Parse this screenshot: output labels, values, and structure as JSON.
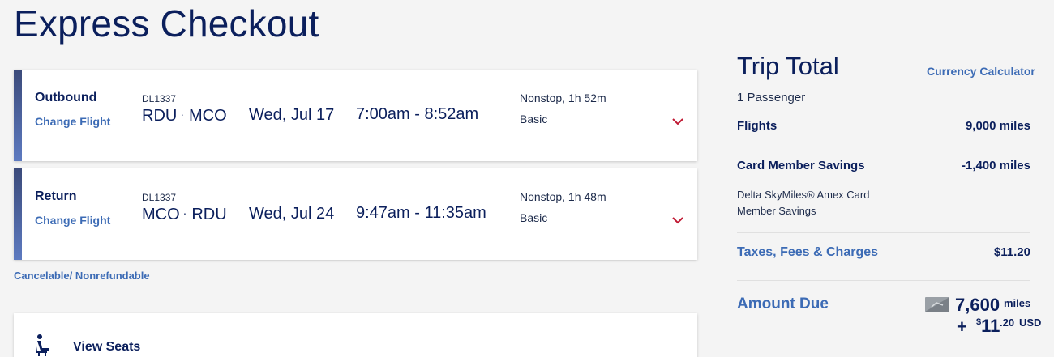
{
  "page": {
    "title": "Express Checkout"
  },
  "flights": [
    {
      "leg": "Outbound",
      "change_label": "Change Flight",
      "flight_number": "DL1337",
      "origin": "RDU",
      "destination": "MCO",
      "date": "Wed, Jul 17",
      "times": "7:00am - 8:52am",
      "duration": "Nonstop, 1h 52m",
      "fare_class": "Basic"
    },
    {
      "leg": "Return",
      "change_label": "Change Flight",
      "flight_number": "DL1337",
      "origin": "MCO",
      "destination": "RDU",
      "date": "Wed, Jul 24",
      "times": "9:47am - 11:35am",
      "duration": "Nonstop, 1h 48m",
      "fare_class": "Basic"
    }
  ],
  "policy": "Cancelable/ Nonrefundable",
  "seats": {
    "label": "View Seats"
  },
  "trip_total": {
    "title": "Trip Total",
    "currency_link": "Currency Calculator",
    "passengers": "1 Passenger",
    "flights_label": "Flights",
    "flights_value": "9,000 miles",
    "savings_label": "Card Member Savings",
    "savings_value": "-1,400 miles",
    "savings_note": "Delta SkyMiles® Amex Card Member Savings",
    "taxes_label": "Taxes, Fees & Charges",
    "taxes_value": "$11.20",
    "amount_due_label": "Amount Due",
    "amount_due_miles": "7,600",
    "amount_due_miles_unit": "miles",
    "amount_due_plus": "+",
    "amount_due_dollar_sign": "$",
    "amount_due_dollars": "11",
    "amount_due_cents": ".20",
    "amount_due_currency": "USD"
  },
  "colors": {
    "brand_navy": "#0b1f5c",
    "link_blue": "#3c6bb5",
    "chevron_red": "#c01933"
  },
  "icons": {
    "expand": "chevron-down-icon",
    "seat": "seat-icon",
    "card": "credit-card-icon"
  }
}
